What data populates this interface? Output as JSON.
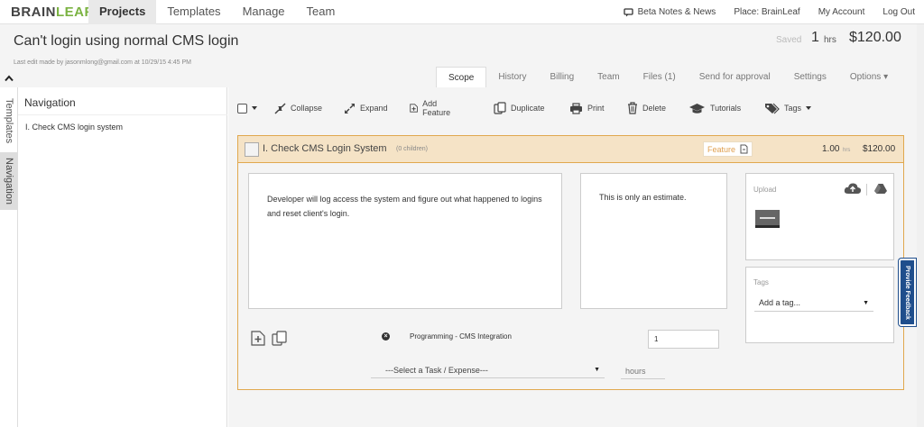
{
  "app": {
    "logo_main": "BRAIN",
    "logo_accent": "LEAF"
  },
  "topnav": [
    {
      "label": "Projects",
      "active": true
    },
    {
      "label": "Templates"
    },
    {
      "label": "Manage"
    },
    {
      "label": "Team"
    }
  ],
  "toplinks": {
    "beta": "Beta Notes & News",
    "place": "Place: BrainLeaf",
    "account": "My Account",
    "logout": "Log Out"
  },
  "project": {
    "title": "Can't login using normal CMS login",
    "last_edit": "Last edit made by jasonmlong@gmail.com at 10/29/15 4:45 PM",
    "saved": "Saved",
    "hours": "1",
    "hours_unit": "hrs",
    "total": "$120.00"
  },
  "tabs": [
    {
      "label": "Scope",
      "active": true
    },
    {
      "label": "History"
    },
    {
      "label": "Billing"
    },
    {
      "label": "Team"
    },
    {
      "label": "Files (1)"
    },
    {
      "label": "Send for approval"
    },
    {
      "label": "Settings"
    },
    {
      "label": "Options ▾"
    }
  ],
  "sidebar": {
    "vtabs": [
      "Templates",
      "Navigation"
    ],
    "title": "Navigation",
    "items": [
      {
        "label": "I. Check CMS login system"
      }
    ]
  },
  "toolbar": {
    "collapse": "Collapse",
    "expand": "Expand",
    "add_feature": "Add Feature",
    "duplicate": "Duplicate",
    "print": "Print",
    "delete": "Delete",
    "tutorials": "Tutorials",
    "tags": "Tags"
  },
  "feature": {
    "title": "I. Check CMS Login System",
    "children": "(0 children)",
    "badge": "Feature",
    "hours": "1.00",
    "hours_unit": "hrs",
    "cost": "$120.00",
    "description": "Developer will log access the system and figure out what happened to logins and reset client's login.",
    "note": "This is only an estimate.",
    "upload_label": "Upload",
    "tags_label": "Tags",
    "tag_placeholder": "Add a tag...",
    "task_name": "Programming - CMS Integration",
    "task_qty": "1",
    "select_task": "---Select a Task / Expense---",
    "hours_placeholder": "hours"
  },
  "feedback": {
    "label": "Provide Feedback"
  },
  "colors": {
    "accent": "#7bb342",
    "feature_border": "#e0a84e",
    "feature_header": "#f5e3c6",
    "feedback": "#1f4e8c"
  }
}
